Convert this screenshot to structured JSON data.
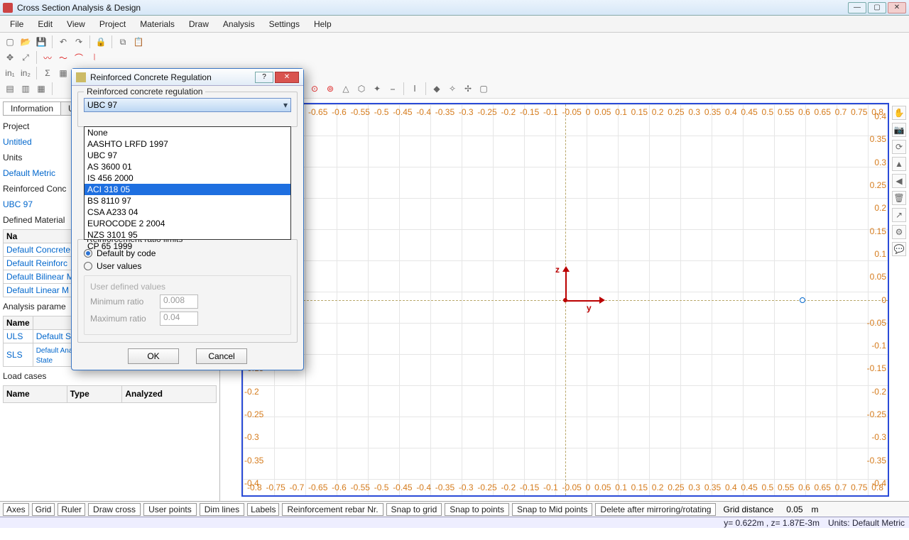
{
  "app": {
    "title": "Cross Section Analysis & Design"
  },
  "menu": [
    "File",
    "Edit",
    "View",
    "Project",
    "Materials",
    "Draw",
    "Analysis",
    "Settings",
    "Help"
  ],
  "sidebar": {
    "tabs": [
      "Information",
      "User"
    ],
    "project_label": "Project",
    "project_value": "Untitled",
    "units_label": "Units",
    "units_value": "Default Metric",
    "regulation_label": "Reinforced Conc",
    "regulation_value": "UBC 97",
    "materials_title": "Defined Material",
    "materials_header": "Na",
    "materials": [
      "Default Concrete",
      "Default Reinforc",
      "Default Bilinear M",
      "Default Linear M"
    ],
    "analysis_title": "Analysis parame",
    "analysis_headers": [
      "Name",
      ""
    ],
    "analysis_rows": [
      {
        "name": "ULS",
        "desc": "Default\nState"
      },
      {
        "name": "SLS",
        "desc": "Default Analysis Parameters Set for Serviceability Limit State"
      }
    ],
    "load_title": "Load cases",
    "load_headers": [
      "Name",
      "Type",
      "Analyzed"
    ]
  },
  "toggles": [
    "Axes",
    "Grid",
    "Ruler",
    "Draw cross",
    "User points",
    "Dim lines",
    "Labels",
    "Reinforcement rebar Nr.",
    "Snap to grid",
    "Snap to points",
    "Snap to Mid points",
    "Delete after mirroring/rotating"
  ],
  "grid_distance_label": "Grid distance",
  "grid_distance_value": "0.05",
  "grid_distance_unit": "m",
  "status": {
    "coords": "y= 0.622m , z= 1.87E-3m",
    "units": "Units: Default Metric"
  },
  "axes": {
    "y_label": "y",
    "z_label": "z"
  },
  "ruler_h": [
    "-0.8",
    "-0.75",
    "-0.7",
    "-0.65",
    "-0.6",
    "-0.55",
    "-0.5",
    "-0.45",
    "-0.4",
    "-0.35",
    "-0.3",
    "-0.25",
    "-0.2",
    "-0.15",
    "-0.1",
    "-0.05",
    "0",
    "0.05",
    "0.1",
    "0.15",
    "0.2",
    "0.25",
    "0.3",
    "0.35",
    "0.4",
    "0.45",
    "0.5",
    "0.55",
    "0.6",
    "0.65",
    "0.7",
    "0.75",
    "0.8"
  ],
  "ruler_v": [
    "0.4",
    "0.35",
    "0.3",
    "0.25",
    "0.2",
    "0.15",
    "0.1",
    "0.05",
    "0",
    "-0.05",
    "-0.1",
    "-0.15",
    "-0.2",
    "-0.25",
    "-0.3",
    "-0.35",
    "-0.4"
  ],
  "dialog": {
    "title": "Reinforced Concrete Regulation",
    "group1_label": "Reinforced concrete regulation",
    "combo_selected": "UBC 97",
    "options": [
      "None",
      "AASHTO LRFD 1997",
      "UBC 97",
      "AS 3600 01",
      "IS 456 2000",
      "ACI 318 05",
      "BS 8110 97",
      "CSA A233 04",
      "EUROCODE 2 2004",
      "NZS 3101 95",
      "CP 65 1999"
    ],
    "highlight_index": 5,
    "group2_label": "Reinforcement ratio limits",
    "radio1": "Default by code",
    "radio2": "User values",
    "subgroup_label": "User defined values",
    "min_label": "Minimum ratio",
    "min_value": "0.008",
    "max_label": "Maximum ratio",
    "max_value": "0.04",
    "ok": "OK",
    "cancel": "Cancel"
  }
}
